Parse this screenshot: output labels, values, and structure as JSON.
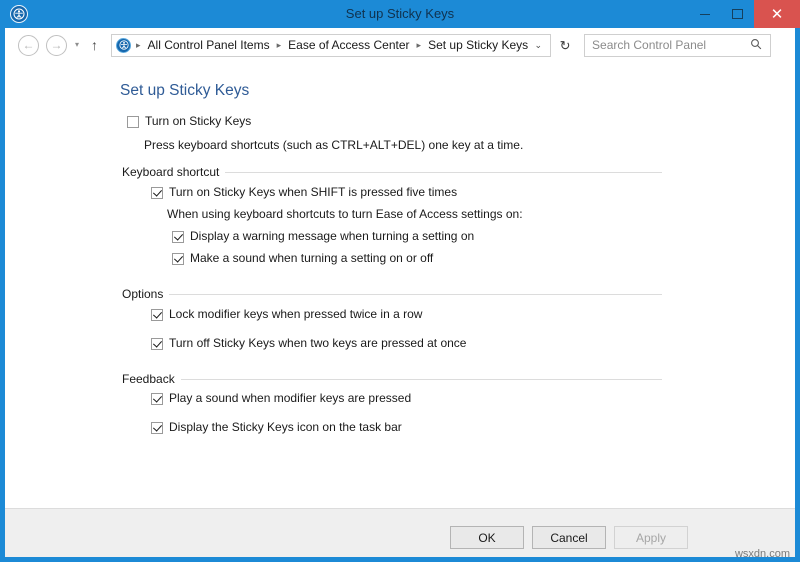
{
  "window": {
    "title": "Set up Sticky Keys",
    "app_icon": "ease-of-access-icon",
    "controls": {
      "minimize": "–",
      "maximize": "□",
      "close": "✕"
    }
  },
  "nav": {
    "back": "←",
    "forward": "→",
    "recent": "▾",
    "up": "↑",
    "address_icon": "ease-of-access-icon",
    "breadcrumbs": [
      "All Control Panel Items",
      "Ease of Access Center",
      "Set up Sticky Keys"
    ],
    "separator": "▸",
    "dropdown": "⌄",
    "refresh": "↻"
  },
  "search": {
    "placeholder": "Search Control Panel",
    "icon": "🔍"
  },
  "main": {
    "page_title": "Set up Sticky Keys",
    "master_checkbox": {
      "label": "Turn on Sticky Keys",
      "checked": false
    },
    "master_description": "Press keyboard shortcuts (such as CTRL+ALT+DEL) one key at a time.",
    "groups": [
      {
        "title": "Keyboard shortcut",
        "items": [
          {
            "label": "Turn on Sticky Keys when SHIFT is pressed five times",
            "checked": true
          }
        ],
        "subtext": "When using keyboard shortcuts to turn Ease of Access settings on:",
        "subitems": [
          {
            "label": "Display a warning message when turning a setting on",
            "checked": true
          },
          {
            "label": "Make a sound when turning a setting on or off",
            "checked": true
          }
        ]
      },
      {
        "title": "Options",
        "items": [
          {
            "label": "Lock modifier keys when pressed twice in a row",
            "checked": true
          },
          {
            "label": "Turn off Sticky Keys when two keys are pressed at once",
            "checked": true
          }
        ]
      },
      {
        "title": "Feedback",
        "items": [
          {
            "label": "Play a sound when modifier keys are pressed",
            "checked": true
          },
          {
            "label": "Display the Sticky Keys icon on the task bar",
            "checked": true
          }
        ]
      }
    ]
  },
  "footer": {
    "ok": "OK",
    "cancel": "Cancel",
    "apply": "Apply"
  },
  "watermark": "wsxdn.com",
  "colors": {
    "titlebar_blue": "#1c8ad6",
    "close_red": "#d9534f",
    "heading_blue": "#2f5b96",
    "footer_grey": "#efefef"
  }
}
